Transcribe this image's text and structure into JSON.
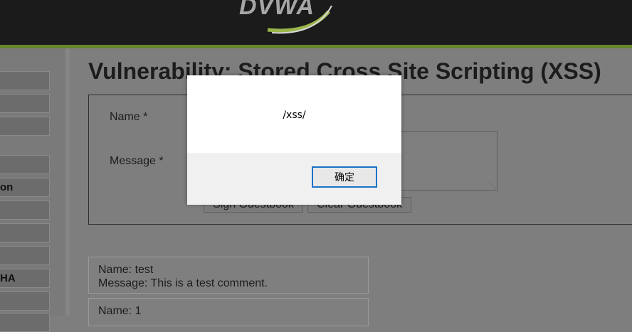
{
  "header": {
    "logo_text": "DVWA",
    "accent_color": "#64862c"
  },
  "sidebar": {
    "items": [
      {
        "label": ""
      },
      {
        "label": ""
      },
      {
        "label": ""
      },
      {
        "label": ""
      },
      {
        "label": "on"
      },
      {
        "label": ""
      },
      {
        "label": ""
      },
      {
        "label": ""
      },
      {
        "label": "HA"
      },
      {
        "label": ""
      },
      {
        "label": ""
      }
    ]
  },
  "main": {
    "title": "Vulnerability: Stored Cross Site Scripting (XSS)",
    "form": {
      "name_label": "Name *",
      "message_label": "Message *",
      "sign_button": "Sign Guestbook",
      "clear_button": "Clear Guestbook"
    },
    "entries": [
      {
        "name": "Name: test",
        "message": "Message: This is a test comment."
      },
      {
        "name": "Name: 1",
        "message": ""
      }
    ]
  },
  "alert": {
    "message": "/xss/",
    "ok_button": "确定"
  }
}
